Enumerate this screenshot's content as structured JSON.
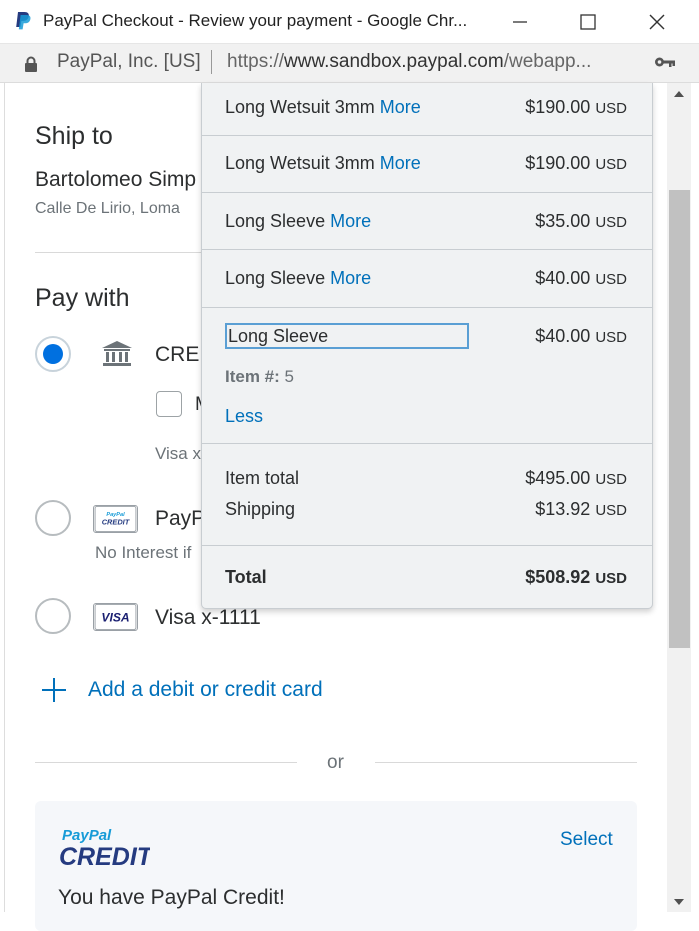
{
  "window": {
    "title": "PayPal Checkout - Review your payment - Google Chr..."
  },
  "address_bar": {
    "organization": "PayPal, Inc. [US]",
    "url_scheme": "https://",
    "url_host": "www.sandbox.paypal.com",
    "url_path": "/webapp..."
  },
  "shipping": {
    "heading": "Ship to",
    "name": "Bartolomeo Simp",
    "address": "Calle De Lirio, Loma"
  },
  "pay_with": {
    "heading": "Pay with",
    "options": [
      {
        "label": "CRE",
        "selected": true,
        "icon": "bank-icon"
      },
      {
        "label": "PayP",
        "selected": false,
        "icon": "paypal-credit-badge",
        "badge_text": "PayPal CREDIT",
        "subtext": "No Interest if"
      },
      {
        "label": "Visa  x-1111",
        "selected": false,
        "icon": "visa-badge",
        "badge_text": "VISA"
      }
    ],
    "checkbox_label": "M",
    "checkbox_checked": false,
    "bank_subtext": "Visa x",
    "add_card": "Add a debit or credit card",
    "or": "or"
  },
  "credit_promo": {
    "logo_line1": "PayPal",
    "logo_line2": "CREDIT",
    "select": "Select",
    "message": "You have PayPal Credit!"
  },
  "cart": {
    "more_label": "More",
    "less_label": "Less",
    "items": [
      {
        "name": "Long Wetsuit 3mm",
        "price": "$190.00",
        "currency": "USD"
      },
      {
        "name": "Long Wetsuit 3mm",
        "price": "$190.00",
        "currency": "USD"
      },
      {
        "name": "Long Sleeve",
        "price": "$35.00",
        "currency": "USD"
      },
      {
        "name": "Long Sleeve",
        "price": "$40.00",
        "currency": "USD"
      }
    ],
    "expanded_item": {
      "name": "Long Sleeve",
      "price": "$40.00",
      "currency": "USD",
      "item_number_label": "Item #:",
      "item_number": "5"
    },
    "item_total_label": "Item total",
    "item_total": "$495.00",
    "shipping_label": "Shipping",
    "shipping": "$13.92",
    "total_label": "Total",
    "total": "$508.92",
    "currency": "USD"
  },
  "colors": {
    "link": "#0070ba",
    "radio_selected": "#0070e0",
    "text": "#2c2e2f",
    "muted": "#6c7378"
  }
}
